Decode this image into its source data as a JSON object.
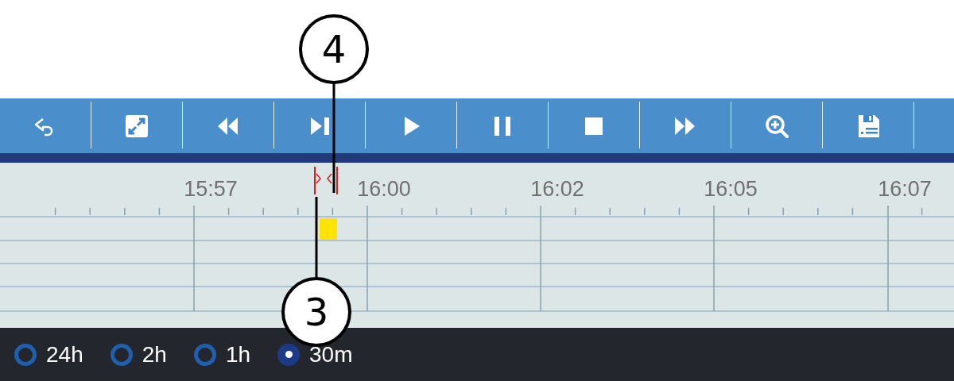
{
  "toolbar": {
    "buttons": [
      {
        "kind": "back"
      },
      {
        "kind": "fullscreen"
      },
      {
        "kind": "rewind"
      },
      {
        "kind": "step"
      },
      {
        "kind": "play"
      },
      {
        "kind": "pause"
      },
      {
        "kind": "stop"
      },
      {
        "kind": "fast-forward"
      },
      {
        "kind": "zoom-in"
      },
      {
        "kind": "save"
      }
    ]
  },
  "timeline": {
    "time_labels": [
      "15:57",
      "16:00",
      "16:02",
      "16:05",
      "16:07"
    ]
  },
  "range_options": [
    {
      "label": "24h",
      "selected": false
    },
    {
      "label": "2h",
      "selected": false
    },
    {
      "label": "1h",
      "selected": false
    },
    {
      "label": "30m",
      "selected": true
    }
  ],
  "callouts": [
    {
      "label": "4"
    },
    {
      "label": "3"
    }
  ]
}
